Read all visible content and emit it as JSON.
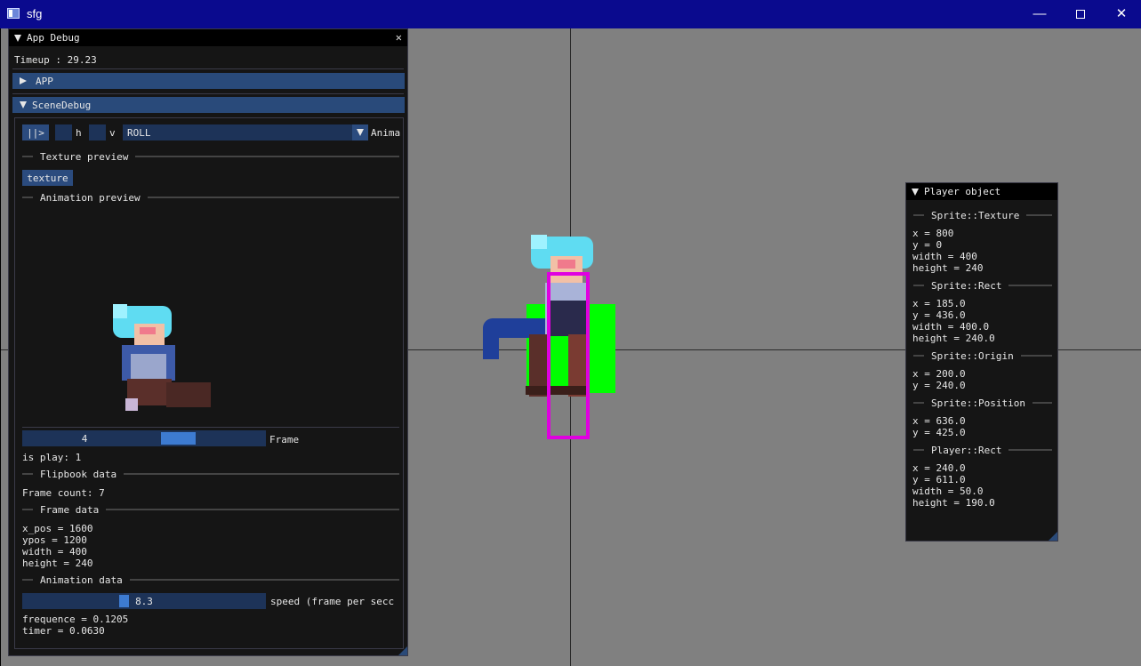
{
  "window": {
    "title": "sfg",
    "minimize": "—",
    "close": "✕"
  },
  "app_debug": {
    "title": "App Debug",
    "close": "✕",
    "timeup": "Timeup : 29.23",
    "app_header": "APP",
    "scene_header": "SceneDebug",
    "controls": {
      "play_button": "||>",
      "h_label": "h",
      "v_label": "v",
      "animation_select": "ROLL",
      "animation_label": "Anima"
    },
    "texture_preview": "Texture preview",
    "texture_button": "texture",
    "animation_preview": "Animation preview",
    "frame_slider": {
      "value": "4",
      "label": "Frame",
      "min": 0,
      "max": 7
    },
    "is_play": "is play: 1",
    "flipbook_data": "Flipbook data",
    "frame_count": "Frame count: 7",
    "frame_data": "Frame data",
    "frame_lines": [
      "x_pos = 1600",
      "ypos = 1200",
      "width = 400",
      "height = 240"
    ],
    "animation_data": "Animation data",
    "speed_slider": {
      "value": "8.3",
      "label": "speed (frame per secc"
    },
    "anim_lines": [
      "frequence = 0.1205",
      "timer = 0.0630"
    ]
  },
  "player_object": {
    "title": "Player object",
    "sections": [
      {
        "header": "Sprite::Texture",
        "lines": [
          "x = 800",
          "y = 0",
          "width = 400",
          "height = 240"
        ]
      },
      {
        "header": "Sprite::Rect",
        "lines": [
          "x = 185.0",
          "y = 436.0",
          "width = 400.0",
          "height = 240.0"
        ]
      },
      {
        "header": "Sprite::Origin",
        "lines": [
          "x = 200.0",
          "y = 240.0"
        ]
      },
      {
        "header": "Sprite::Position",
        "lines": [
          "x = 636.0",
          "y = 425.0"
        ]
      },
      {
        "header": "Player::Rect",
        "lines": [
          "x = 240.0",
          "y = 611.0",
          "width = 50.0",
          "height = 190.0"
        ]
      }
    ]
  },
  "colors": {
    "titlebar": "#0a0a8e",
    "viewport": "#808080",
    "panel": "#151515",
    "header": "#294a7a",
    "frame_bg": "#1d3358",
    "slider_grab": "#3d7bd1",
    "hitbox": "#00ff00",
    "player_rect": "#ff00ff"
  }
}
